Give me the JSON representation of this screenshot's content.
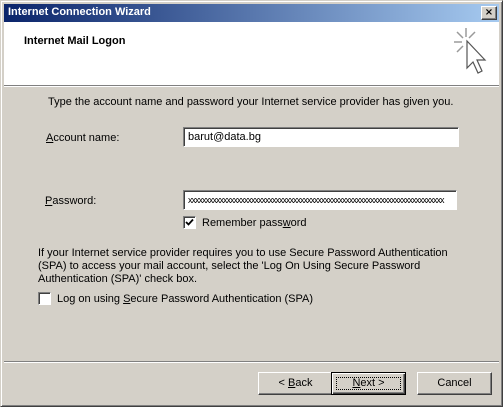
{
  "window": {
    "title": "Internet Connection Wizard",
    "close_glyph": "×"
  },
  "header": {
    "title": "Internet Mail Logon",
    "icon": "wizard-sparkle-cursor-icon"
  },
  "instruction": "Type the account name and password your Internet service provider has given you.",
  "account": {
    "label_key": "A",
    "label_rest": "ccount name:",
    "value": "barut@data.bg"
  },
  "password": {
    "label_key": "P",
    "label_rest": "assword:",
    "value": "xxxxxxxxxxxxxxxxxxxxxxxxxxxxxxxxxxxxxxxxxxxxxxxxxxxxxxxxxxxxxxxxxxxxxxxxx"
  },
  "remember": {
    "label_pre": "Remember pass",
    "label_key": "w",
    "label_post": "ord",
    "checked": true
  },
  "spa_info": "If your Internet service provider requires you to use Secure Password Authentication (SPA) to access your mail account, select the 'Log On Using Secure Password Authentication (SPA)' check box.",
  "spa": {
    "label_pre": "Log on using ",
    "label_key": "S",
    "label_post": "ecure Password Authentication (SPA)",
    "checked": false
  },
  "buttons": {
    "back_pre": "< ",
    "back_key": "B",
    "back_post": "ack",
    "next_key": "N",
    "next_post": "ext >",
    "cancel": "Cancel"
  }
}
